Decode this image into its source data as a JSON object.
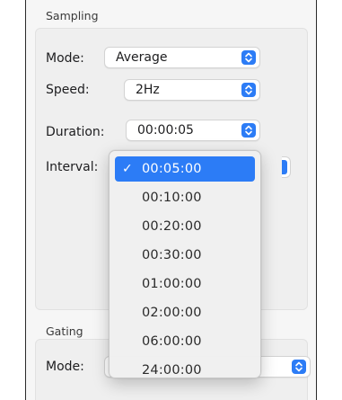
{
  "sampling": {
    "title": "Sampling",
    "mode": {
      "label": "Mode:",
      "value": "Average"
    },
    "speed": {
      "label": "Speed:",
      "value": "2Hz"
    },
    "duration": {
      "label": "Duration:",
      "value": "00:00:05"
    },
    "interval": {
      "label": "Interval:",
      "selected": "00:05:00",
      "options": [
        "00:05:00",
        "00:10:00",
        "00:20:00",
        "00:30:00",
        "01:00:00",
        "02:00:00",
        "06:00:00",
        "24:00:00"
      ]
    }
  },
  "gating": {
    "title": "Gating",
    "mode": {
      "label": "Mode:",
      "value": ""
    }
  },
  "colors": {
    "accent": "#2c7cf6",
    "panel": "#f6f6f6",
    "groupbox": "#efefef"
  },
  "icons": {
    "popup_arrows": "up-down-chevron-icon",
    "checkmark": "checkmark-icon"
  }
}
